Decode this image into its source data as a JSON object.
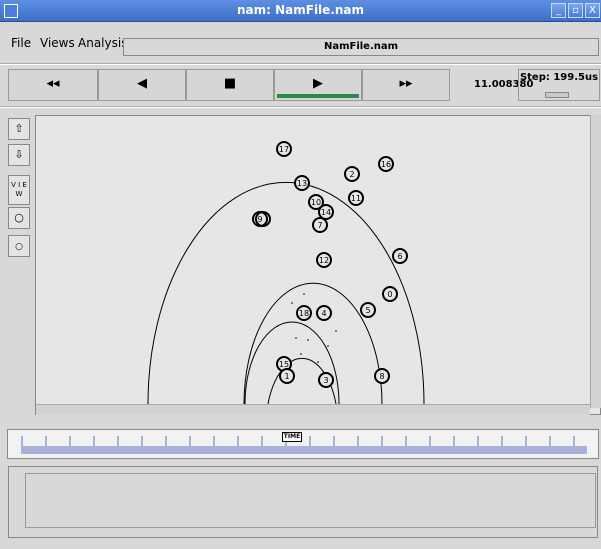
{
  "window": {
    "title": "nam: NamFile.nam"
  },
  "menubar": {
    "file": "File",
    "views": "Views",
    "analysis": "Analysis",
    "filename": "NamFile.nam"
  },
  "transport": {
    "rewind": "◂◂",
    "back": "◀",
    "stop": "■",
    "play": "▶",
    "fastforward": "▸▸",
    "time": "11.008380",
    "step": "Step: 199.5us"
  },
  "leftbar": {
    "view_label": "V I E W"
  },
  "timeline": {
    "marker": "TIME"
  },
  "nodes": [
    {
      "id": "17"
    },
    {
      "id": "2"
    },
    {
      "id": "16"
    },
    {
      "id": "13"
    },
    {
      "id": "11"
    },
    {
      "id": "10"
    },
    {
      "id": "14"
    },
    {
      "id": "7"
    },
    {
      "id": "9"
    },
    {
      "id": "6"
    },
    {
      "id": "12"
    },
    {
      "id": "0"
    },
    {
      "id": "5"
    },
    {
      "id": "18"
    },
    {
      "id": "4"
    },
    {
      "id": "15"
    },
    {
      "id": "1"
    },
    {
      "id": "3"
    },
    {
      "id": "8"
    }
  ],
  "colors": {
    "titlebar": "#3e6fc7",
    "play_underline": "#2d8a4e"
  }
}
